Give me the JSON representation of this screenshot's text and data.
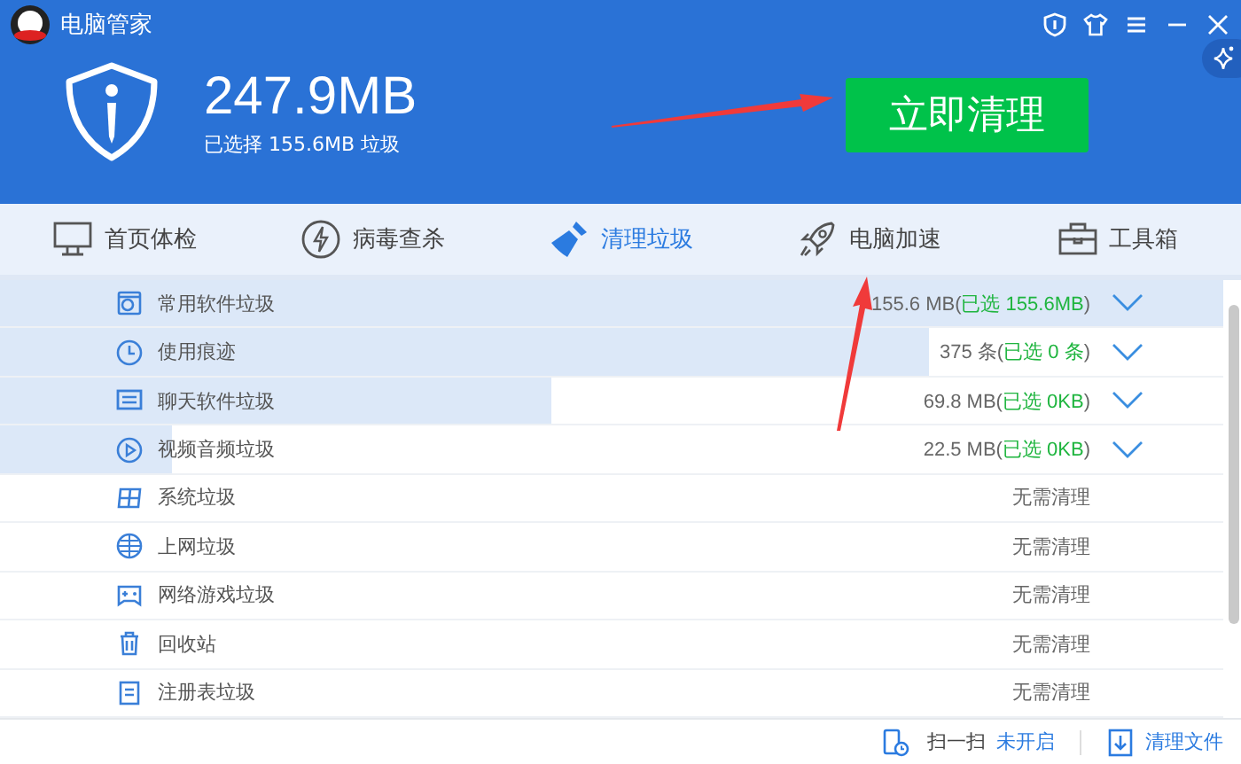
{
  "window": {
    "title": "电脑管家"
  },
  "summary": {
    "total": "247.9MB",
    "selected": "已选择 155.6MB 垃圾"
  },
  "clean_button": "立即清理",
  "tabs": [
    {
      "label": "首页体检",
      "selected": false
    },
    {
      "label": "病毒查杀",
      "selected": false
    },
    {
      "label": "清理垃圾",
      "selected": true
    },
    {
      "label": "电脑加速",
      "selected": false
    },
    {
      "label": "工具箱",
      "selected": false
    }
  ],
  "items": [
    {
      "name": "常用软件垃圾",
      "kind": "found",
      "level": 1,
      "amount": "155.6 MB(",
      "chosen": "已选 155.6MB",
      "amount_end": ")"
    },
    {
      "name": "使用痕迹",
      "kind": "found",
      "level": 0.76,
      "amount": "375 条(",
      "chosen": "已选 0 条",
      "amount_end": ")"
    },
    {
      "name": "聊天软件垃圾",
      "kind": "found",
      "level": 0.45,
      "amount": "69.8 MB(",
      "chosen": "已选 0KB",
      "amount_end": ")"
    },
    {
      "name": "视频音频垃圾",
      "kind": "found",
      "level": 0.14,
      "amount": "22.5 MB(",
      "chosen": "已选 0KB",
      "amount_end": ")"
    },
    {
      "name": "系统垃圾",
      "kind": "clean",
      "status": "无需清理"
    },
    {
      "name": "上网垃圾",
      "kind": "clean",
      "status": "无需清理"
    },
    {
      "name": "网络游戏垃圾",
      "kind": "clean",
      "status": "无需清理"
    },
    {
      "name": "回收站",
      "kind": "clean",
      "status": "无需清理"
    },
    {
      "name": "注册表垃圾",
      "kind": "clean",
      "status": "无需清理"
    }
  ],
  "footer": {
    "scan_label": "扫一扫",
    "scan_state": "未开启",
    "clean_files": "清理文件"
  }
}
